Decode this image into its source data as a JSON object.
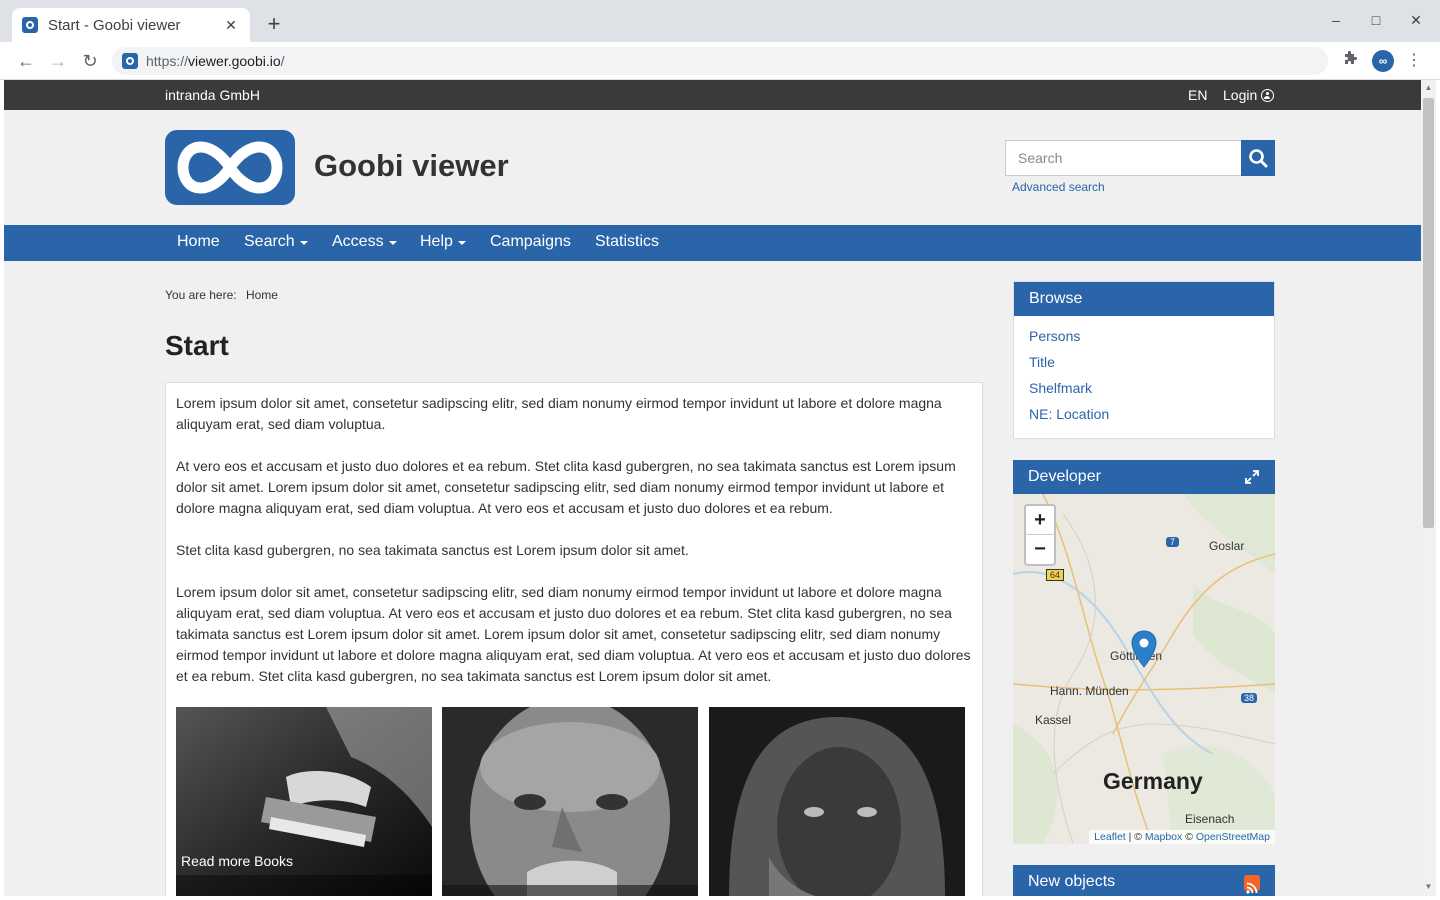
{
  "browser": {
    "tab_title": "Start - Goobi viewer",
    "url_scheme": "https://",
    "url_host": "viewer.goobi.io",
    "url_path": "/"
  },
  "topbar": {
    "company": "intranda GmbH",
    "language": "EN",
    "login": "Login"
  },
  "header": {
    "site_title": "Goobi viewer",
    "search_placeholder": "Search",
    "advanced_search": "Advanced search"
  },
  "nav": {
    "home": "Home",
    "search": "Search",
    "access": "Access",
    "help": "Help",
    "campaigns": "Campaigns",
    "statistics": "Statistics"
  },
  "breadcrumb": {
    "prefix": "You are here:",
    "current": "Home"
  },
  "page": {
    "title": "Start",
    "paragraphs": [
      "Lorem ipsum dolor sit amet, consetetur sadipscing elitr, sed diam nonumy eirmod tempor invidunt ut labore et dolore magna aliquyam erat, sed diam voluptua.",
      "At vero eos et accusam et justo duo dolores et ea rebum. Stet clita kasd gubergren, no sea takimata sanctus est Lorem ipsum dolor sit amet. Lorem ipsum dolor sit amet, consetetur sadipscing elitr, sed diam nonumy eirmod tempor invidunt ut labore et dolore magna aliquyam erat, sed diam voluptua. At vero eos et accusam et justo duo dolores et ea rebum.",
      "Stet clita kasd gubergren, no sea takimata sanctus est Lorem ipsum dolor sit amet.",
      "Lorem ipsum dolor sit amet, consetetur sadipscing elitr, sed diam nonumy eirmod tempor invidunt ut labore et dolore magna aliquyam erat, sed diam voluptua. At vero eos et accusam et justo duo dolores et ea rebum. Stet clita kasd gubergren, no sea takimata sanctus est Lorem ipsum dolor sit amet. Lorem ipsum dolor sit amet, consetetur sadipscing elitr, sed diam nonumy eirmod tempor invidunt ut labore et dolore magna aliquyam erat, sed diam voluptua. At vero eos et accusam et justo duo dolores et ea rebum. Stet clita kasd gubergren, no sea takimata sanctus est Lorem ipsum dolor sit amet."
    ],
    "tile_label": "Read more Books"
  },
  "sidebar": {
    "browse_title": "Browse",
    "browse_links": [
      "Persons",
      "Title",
      "Shelfmark",
      "NE: Location"
    ],
    "developer_title": "Developer",
    "new_objects_title": "New objects"
  },
  "map": {
    "labels": {
      "goslar": "Goslar",
      "gottingen": "Göttingen",
      "hann": "Hann. Münden",
      "kassel": "Kassel",
      "germany": "Germany",
      "eisenach": "Eisenach",
      "shield_7": "7",
      "shield_64": "64",
      "shield_38": "38"
    },
    "attribution_leaflet": "Leaflet",
    "attribution_sep": " | © ",
    "attribution_mapbox": "Mapbox",
    "attribution_copy": " © ",
    "attribution_osm": "OpenStreetMap"
  },
  "colors": {
    "brand": "#2a65a9",
    "topbar": "#3a3a3a"
  }
}
